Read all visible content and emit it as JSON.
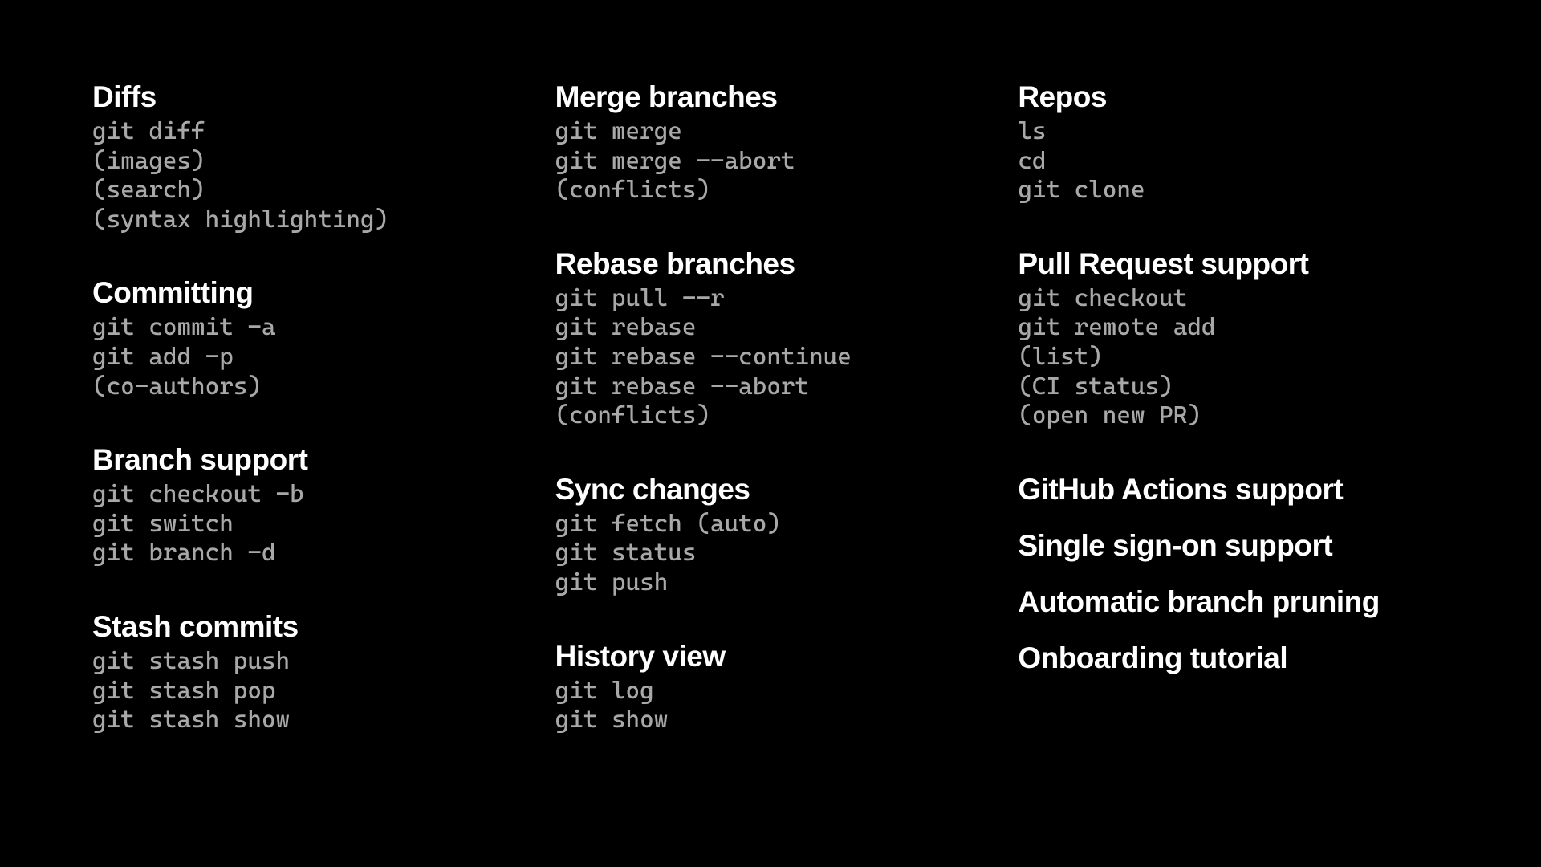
{
  "columns": [
    {
      "sections": [
        {
          "title": "Diffs",
          "items": [
            "git diff",
            "(images)",
            "(search)",
            "(syntax highlighting)"
          ]
        },
        {
          "title": "Committing",
          "items": [
            "git commit -a",
            "git add -p",
            "(co-authors)"
          ]
        },
        {
          "title": "Branch support",
          "items": [
            "git checkout -b",
            "git switch",
            "git branch -d"
          ]
        },
        {
          "title": "Stash commits",
          "items": [
            "git stash push",
            "git stash pop",
            "git stash show"
          ]
        }
      ],
      "standalone": []
    },
    {
      "sections": [
        {
          "title": "Merge branches",
          "items": [
            "git merge",
            "git merge --abort",
            "(conflicts)"
          ]
        },
        {
          "title": "Rebase branches",
          "items": [
            "git pull --r",
            "git rebase",
            "git rebase --continue",
            "git rebase --abort",
            "(conflicts)"
          ]
        },
        {
          "title": "Sync changes",
          "items": [
            "git fetch (auto)",
            "git status",
            "git push"
          ]
        },
        {
          "title": "History view",
          "items": [
            "git log",
            "git show"
          ]
        }
      ],
      "standalone": []
    },
    {
      "sections": [
        {
          "title": "Repos",
          "items": [
            "ls",
            "cd",
            "git clone"
          ]
        },
        {
          "title": "Pull Request support",
          "items": [
            "git checkout",
            "git remote add",
            "(list)",
            "(CI status)",
            "(open new PR)"
          ]
        }
      ],
      "standalone": [
        "GitHub Actions support",
        "Single sign-on support",
        "Automatic branch pruning",
        "Onboarding tutorial"
      ]
    }
  ]
}
